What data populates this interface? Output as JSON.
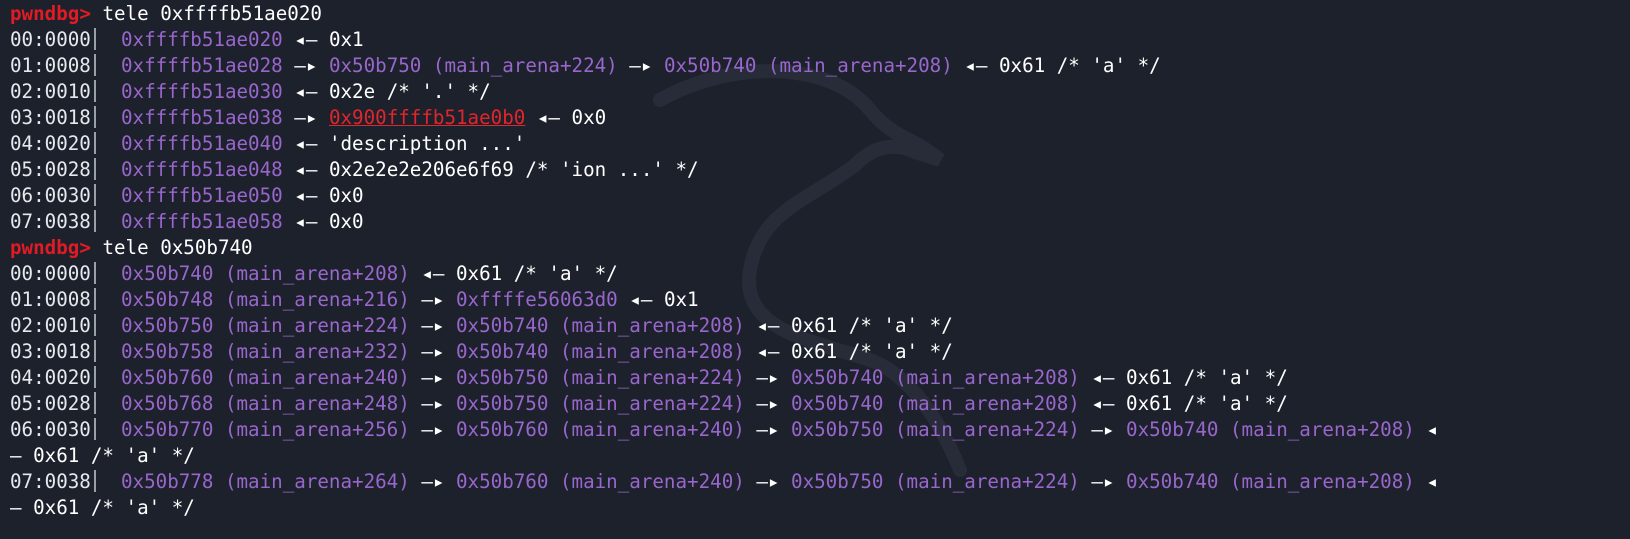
{
  "prompt": "pwndbg",
  "prompt_caret": ">",
  "arrow_to": " —▸ ",
  "arrow_val": " ◂— ",
  "blocks": [
    {
      "command": "tele 0xffffb51ae020",
      "rows": [
        {
          "off": "00:0000",
          "segs": [
            {
              "t": "0xffffb51ae020",
              "c": "purple"
            },
            {
              "t": " ◂— ",
              "c": "white"
            },
            {
              "t": "0x1",
              "c": "white"
            }
          ]
        },
        {
          "off": "01:0008",
          "segs": [
            {
              "t": "0xffffb51ae028",
              "c": "purple"
            },
            {
              "t": " —▸ ",
              "c": "white"
            },
            {
              "t": "0x50b750 (main_arena+224)",
              "c": "purple"
            },
            {
              "t": " —▸ ",
              "c": "white"
            },
            {
              "t": "0x50b740 (main_arena+208)",
              "c": "purple"
            },
            {
              "t": " ◂— ",
              "c": "white"
            },
            {
              "t": "0x61 /* 'a' */",
              "c": "white"
            }
          ]
        },
        {
          "off": "02:0010",
          "segs": [
            {
              "t": "0xffffb51ae030",
              "c": "purple"
            },
            {
              "t": " ◂— ",
              "c": "white"
            },
            {
              "t": "0x2e /* '.' */",
              "c": "white"
            }
          ]
        },
        {
          "off": "03:0018",
          "segs": [
            {
              "t": "0xffffb51ae038",
              "c": "purple"
            },
            {
              "t": " —▸ ",
              "c": "white"
            },
            {
              "t": "0x900ffffb51ae0b0",
              "c": "red"
            },
            {
              "t": " ◂— ",
              "c": "white"
            },
            {
              "t": "0x0",
              "c": "white"
            }
          ]
        },
        {
          "off": "04:0020",
          "segs": [
            {
              "t": "0xffffb51ae040",
              "c": "purple"
            },
            {
              "t": " ◂— ",
              "c": "white"
            },
            {
              "t": "'description ...'",
              "c": "white"
            }
          ]
        },
        {
          "off": "05:0028",
          "segs": [
            {
              "t": "0xffffb51ae048",
              "c": "purple"
            },
            {
              "t": " ◂— ",
              "c": "white"
            },
            {
              "t": "0x2e2e2e206e6f69 /* 'ion ...' */",
              "c": "white"
            }
          ]
        },
        {
          "off": "06:0030",
          "segs": [
            {
              "t": "0xffffb51ae050",
              "c": "purple"
            },
            {
              "t": " ◂— ",
              "c": "white"
            },
            {
              "t": "0x0",
              "c": "white"
            }
          ]
        },
        {
          "off": "07:0038",
          "segs": [
            {
              "t": "0xffffb51ae058",
              "c": "purple"
            },
            {
              "t": " ◂— ",
              "c": "white"
            },
            {
              "t": "0x0",
              "c": "white"
            }
          ]
        }
      ]
    },
    {
      "command": "tele 0x50b740",
      "rows": [
        {
          "off": "00:0000",
          "segs": [
            {
              "t": "0x50b740 (main_arena+208)",
              "c": "purple"
            },
            {
              "t": " ◂— ",
              "c": "white"
            },
            {
              "t": "0x61 /* 'a' */",
              "c": "white"
            }
          ]
        },
        {
          "off": "01:0008",
          "segs": [
            {
              "t": "0x50b748 (main_arena+216)",
              "c": "purple"
            },
            {
              "t": " —▸ ",
              "c": "white"
            },
            {
              "t": "0xffffe56063d0",
              "c": "purple"
            },
            {
              "t": " ◂— ",
              "c": "white"
            },
            {
              "t": "0x1",
              "c": "white"
            }
          ]
        },
        {
          "off": "02:0010",
          "segs": [
            {
              "t": "0x50b750 (main_arena+224)",
              "c": "purple"
            },
            {
              "t": " —▸ ",
              "c": "white"
            },
            {
              "t": "0x50b740 (main_arena+208)",
              "c": "purple"
            },
            {
              "t": " ◂— ",
              "c": "white"
            },
            {
              "t": "0x61 /* 'a' */",
              "c": "white"
            }
          ]
        },
        {
          "off": "03:0018",
          "segs": [
            {
              "t": "0x50b758 (main_arena+232)",
              "c": "purple"
            },
            {
              "t": " —▸ ",
              "c": "white"
            },
            {
              "t": "0x50b740 (main_arena+208)",
              "c": "purple"
            },
            {
              "t": " ◂— ",
              "c": "white"
            },
            {
              "t": "0x61 /* 'a' */",
              "c": "white"
            }
          ]
        },
        {
          "off": "04:0020",
          "segs": [
            {
              "t": "0x50b760 (main_arena+240)",
              "c": "purple"
            },
            {
              "t": " —▸ ",
              "c": "white"
            },
            {
              "t": "0x50b750 (main_arena+224)",
              "c": "purple"
            },
            {
              "t": " —▸ ",
              "c": "white"
            },
            {
              "t": "0x50b740 (main_arena+208)",
              "c": "purple"
            },
            {
              "t": " ◂— ",
              "c": "white"
            },
            {
              "t": "0x61 /* 'a' */",
              "c": "white"
            }
          ]
        },
        {
          "off": "05:0028",
          "segs": [
            {
              "t": "0x50b768 (main_arena+248)",
              "c": "purple"
            },
            {
              "t": " —▸ ",
              "c": "white"
            },
            {
              "t": "0x50b750 (main_arena+224)",
              "c": "purple"
            },
            {
              "t": " —▸ ",
              "c": "white"
            },
            {
              "t": "0x50b740 (main_arena+208)",
              "c": "purple"
            },
            {
              "t": " ◂— ",
              "c": "white"
            },
            {
              "t": "0x61 /* 'a' */",
              "c": "white"
            }
          ]
        },
        {
          "off": "06:0030",
          "segs": [
            {
              "t": "0x50b770 (main_arena+256)",
              "c": "purple"
            },
            {
              "t": " —▸ ",
              "c": "white"
            },
            {
              "t": "0x50b760 (main_arena+240)",
              "c": "purple"
            },
            {
              "t": " —▸ ",
              "c": "white"
            },
            {
              "t": "0x50b750 (main_arena+224)",
              "c": "purple"
            },
            {
              "t": " —▸ ",
              "c": "white"
            },
            {
              "t": "0x50b740 (main_arena+208)",
              "c": "purple"
            },
            {
              "t": " ◂",
              "c": "white"
            }
          ],
          "wrap": "— 0x61 /* 'a' */"
        },
        {
          "off": "07:0038",
          "segs": [
            {
              "t": "0x50b778 (main_arena+264)",
              "c": "purple"
            },
            {
              "t": " —▸ ",
              "c": "white"
            },
            {
              "t": "0x50b760 (main_arena+240)",
              "c": "purple"
            },
            {
              "t": " —▸ ",
              "c": "white"
            },
            {
              "t": "0x50b750 (main_arena+224)",
              "c": "purple"
            },
            {
              "t": " —▸ ",
              "c": "white"
            },
            {
              "t": "0x50b740 (main_arena+208)",
              "c": "purple"
            },
            {
              "t": " ◂",
              "c": "white"
            }
          ],
          "wrap": "— 0x61 /* 'a' */"
        }
      ]
    }
  ],
  "colors": {
    "background": "#1c212c",
    "prompt": "#e01b24",
    "address": "#9966cc",
    "value": "#ffffff",
    "bad_pointer": "#e0262d"
  }
}
